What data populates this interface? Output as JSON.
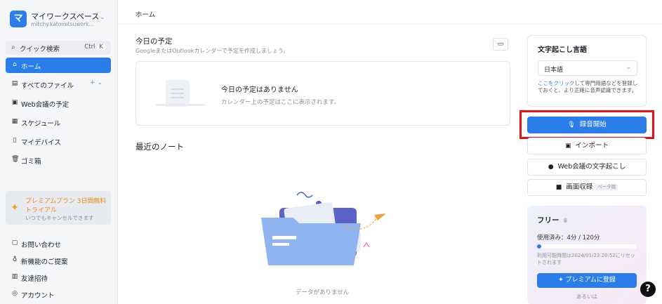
{
  "workspace": {
    "name": "マイワークスペース",
    "subtitle": "mitchy.katomitsuwork...",
    "logo": "マ"
  },
  "sidebar": {
    "search": {
      "label": "クイック検索",
      "shortcut_ctrl": "Ctrl",
      "shortcut_key": "K"
    },
    "items": [
      {
        "label": "ホーム",
        "icon": "home-icon",
        "active": true
      },
      {
        "label": "すべてのファイル",
        "icon": "files-icon",
        "active": false
      },
      {
        "label": "Web会議の予定",
        "icon": "calendar-icon",
        "active": false
      },
      {
        "label": "スケジュール",
        "icon": "schedule-icon",
        "active": false
      },
      {
        "label": "マイデバイス",
        "icon": "device-icon",
        "active": false
      },
      {
        "label": "ゴミ箱",
        "icon": "trash-icon",
        "active": false
      }
    ],
    "promo": {
      "line1": "プレミアムプラン 3日間無料",
      "line2": "トライアル",
      "line3": "いつでもキャンセルできます"
    },
    "bottom_items": [
      {
        "label": "お問い合わせ",
        "icon": "contact-icon"
      },
      {
        "label": "新機能のご提案",
        "icon": "lightbulb-icon"
      },
      {
        "label": "友達招待",
        "icon": "gift-icon"
      },
      {
        "label": "アカウント",
        "icon": "account-icon"
      }
    ]
  },
  "main": {
    "breadcrumb": "ホーム",
    "today": {
      "title": "今日の予定",
      "subtitle": "GoogleまたはOutlookカレンダーで予定を作成しましょう。",
      "empty_title": "今日の予定はありません",
      "empty_desc": "カレンダー上の予定はここに表示されます。"
    },
    "notes": {
      "title": "最近のノート",
      "empty": "データがありません"
    }
  },
  "right": {
    "lang": {
      "title": "文字起こし言語",
      "value": "日本語",
      "hint_link": "ここをクリック",
      "hint_text": "して専門用語などを登録しておくと、より正確に音声認識できます。"
    },
    "record_button": "録音開始",
    "import_button": "インポート",
    "web_transcribe_button": "Web会議の文字起こし",
    "screen_record_button": "画面収録",
    "screen_record_badge": "ベータ版",
    "plan": {
      "name": "フリー",
      "usage": "使用済み：4分 / 120分",
      "usage_fraction": 0.033,
      "reset": "利用可能時間は2024/01/23 20:52にリセットされます",
      "upgrade": "プレミアムに登録",
      "or": "あるいは"
    }
  },
  "help": "?"
}
